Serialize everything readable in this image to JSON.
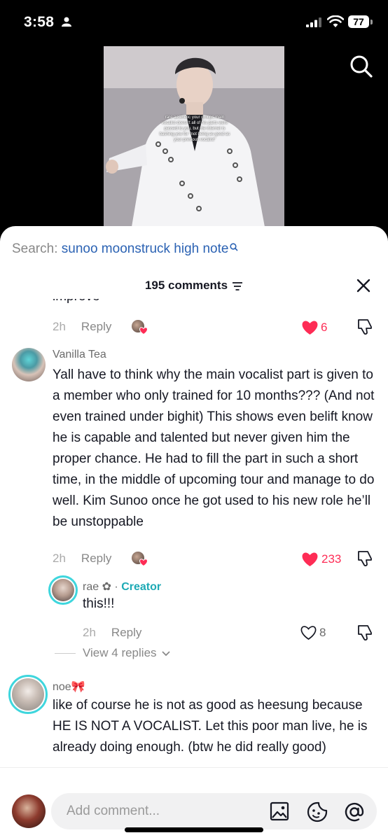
{
  "status_bar": {
    "time": "3:58",
    "battery": "77"
  },
  "video": {
    "caption": "rare aesthetic your groups main vocalist doesn't all of his parts were passed to you, but the internet is bashing you for \"not being as good as your previous vocalist\""
  },
  "search": {
    "prefix": "Search: ",
    "query": "sunoo moonstruck high note"
  },
  "comments_header": {
    "count_label": "195 comments"
  },
  "comments": {
    "partial": {
      "cut_text": "improve",
      "time": "2h",
      "reply_label": "Reply",
      "likes": "6",
      "liked": true
    },
    "c1": {
      "username": "Vanilla Tea",
      "text": "Yall have to think why the main vocalist part is given to a member who only trained for 10 months??? (And not even trained under bighit) This shows even belift know he is capable and talented but never given him the proper chance. He had to fill the part in such a short time, in the middle of upcoming tour and manage to do well. Kim Sunoo once he got used to his new role he’ll be unstoppable",
      "time": "2h",
      "reply_label": "Reply",
      "likes": "233",
      "liked": true
    },
    "reply1": {
      "username": "rae ✿",
      "separator": " · ",
      "creator_label": "Creator",
      "text": "this!!!",
      "time": "2h",
      "reply_label": "Reply",
      "likes": "8",
      "liked": false
    },
    "view_replies": "View 4 replies",
    "c2": {
      "username": "noe🎀",
      "text": "like of course he is not as good as heesung because HE IS NOT A VOCALIST. Let this poor man live, he is already doing enough. (btw he did really good)"
    }
  },
  "composer": {
    "placeholder": "Add comment..."
  },
  "colors": {
    "like_red": "#fe2c55",
    "link_blue": "#2b62b3",
    "creator_teal": "#1eaab5"
  }
}
